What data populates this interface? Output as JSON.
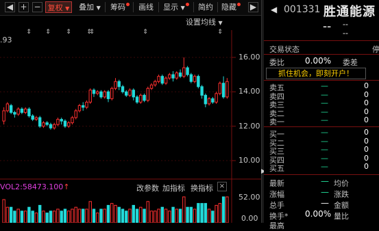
{
  "toolbar": {
    "left_arrow": "◀",
    "plus": "+",
    "minus": "−",
    "fuquan": "复权",
    "diejia": "叠加",
    "chouma": "筹码",
    "huaxian": "画线",
    "xianshi": "显示",
    "jianyue": "简约",
    "yincang": "隐藏",
    "right_arrow": "▶"
  },
  "chart": {
    "settings_label": "设置均线",
    "price_fragment": ".93",
    "y_ticks": [
      "16.00",
      "14.00",
      "12.00",
      "10.00"
    ],
    "vol_label": "VOL2:58473.100",
    "vol_arrow": "↑",
    "vol_buttons": [
      "改参数",
      "加指标",
      "换指标"
    ],
    "vol_close": "×",
    "vol_ticks": [
      "52.00",
      "0.00"
    ]
  },
  "chart_data": {
    "type": "candlestick",
    "ylim": [
      9.0,
      17.0
    ],
    "y_ticks": [
      16,
      14,
      12,
      10
    ],
    "candles": [
      [
        12.3,
        12.9,
        12.1,
        13.1
      ],
      [
        12.9,
        13.3,
        12.8,
        13.4
      ],
      [
        13.2,
        12.8,
        12.7,
        13.3
      ],
      [
        12.8,
        12.7,
        12.5,
        12.9
      ],
      [
        12.7,
        13.0,
        12.6,
        13.1
      ],
      [
        13.0,
        12.8,
        12.7,
        13.1
      ],
      [
        12.8,
        13.0,
        12.7,
        13.1
      ],
      [
        13.0,
        12.6,
        12.5,
        13.1
      ],
      [
        12.6,
        12.4,
        12.3,
        12.7
      ],
      [
        12.4,
        12.5,
        12.3,
        12.6
      ],
      [
        12.5,
        12.0,
        11.9,
        12.6
      ],
      [
        12.0,
        12.2,
        11.9,
        12.3
      ],
      [
        12.2,
        12.1,
        12.0,
        12.3
      ],
      [
        12.1,
        11.9,
        11.8,
        12.2
      ],
      [
        11.9,
        12.1,
        11.8,
        12.2
      ],
      [
        12.1,
        12.4,
        12.0,
        12.5
      ],
      [
        12.4,
        12.3,
        12.1,
        12.5
      ],
      [
        12.3,
        12.0,
        11.9,
        12.4
      ],
      [
        12.0,
        12.2,
        11.9,
        12.3
      ],
      [
        12.2,
        12.5,
        12.1,
        12.6
      ],
      [
        12.5,
        12.9,
        12.4,
        13.0
      ],
      [
        12.9,
        13.2,
        12.8,
        13.3
      ],
      [
        13.2,
        13.1,
        12.9,
        13.4
      ],
      [
        13.1,
        13.4,
        13.0,
        13.5
      ],
      [
        13.4,
        14.1,
        13.3,
        14.2
      ],
      [
        14.1,
        13.9,
        13.7,
        14.2
      ],
      [
        13.9,
        14.0,
        13.8,
        14.1
      ],
      [
        14.0,
        13.7,
        13.6,
        14.1
      ],
      [
        13.7,
        14.0,
        13.6,
        14.1
      ],
      [
        14.0,
        13.6,
        13.4,
        14.1
      ],
      [
        13.6,
        14.2,
        13.5,
        14.3
      ],
      [
        14.2,
        14.6,
        14.1,
        14.8
      ],
      [
        14.6,
        14.3,
        14.1,
        14.7
      ],
      [
        14.3,
        14.0,
        13.9,
        14.4
      ],
      [
        14.0,
        13.8,
        13.7,
        14.1
      ],
      [
        13.8,
        14.1,
        13.7,
        14.2
      ],
      [
        14.1,
        13.7,
        13.5,
        14.2
      ],
      [
        13.7,
        13.4,
        13.3,
        13.8
      ],
      [
        13.4,
        13.8,
        13.3,
        13.9
      ],
      [
        13.8,
        13.5,
        13.4,
        13.9
      ],
      [
        13.5,
        14.2,
        13.4,
        14.3
      ],
      [
        14.2,
        14.4,
        14.1,
        14.5
      ],
      [
        14.4,
        14.6,
        14.3,
        14.7
      ],
      [
        14.6,
        14.9,
        14.5,
        15.0
      ],
      [
        14.9,
        14.5,
        14.4,
        15.0
      ],
      [
        14.5,
        14.8,
        14.4,
        14.9
      ],
      [
        14.8,
        15.0,
        14.7,
        15.1
      ],
      [
        15.0,
        14.8,
        14.6,
        15.2
      ],
      [
        14.8,
        15.1,
        14.7,
        15.2
      ],
      [
        15.1,
        14.9,
        14.8,
        15.3
      ],
      [
        14.9,
        15.4,
        14.8,
        16.0
      ],
      [
        15.4,
        15.0,
        14.9,
        15.5
      ],
      [
        15.0,
        14.6,
        14.5,
        15.1
      ],
      [
        14.6,
        14.9,
        14.5,
        15.0
      ],
      [
        14.9,
        14.3,
        14.2,
        15.0
      ],
      [
        14.3,
        13.8,
        13.6,
        14.4
      ],
      [
        13.8,
        13.3,
        13.1,
        13.9
      ],
      [
        13.3,
        13.6,
        13.2,
        13.7
      ],
      [
        13.6,
        13.4,
        13.3,
        13.7
      ],
      [
        13.4,
        13.9,
        13.3,
        14.0
      ],
      [
        13.9,
        14.5,
        13.8,
        14.6
      ],
      [
        14.5,
        13.7,
        13.6,
        14.9
      ],
      [
        13.7,
        14.6,
        13.6,
        14.8
      ]
    ]
  },
  "quote": {
    "code": "001331",
    "name": "胜通能源",
    "price": "--",
    "change_top": "--",
    "change_bottom": "--",
    "trade_status_label": "交易状态",
    "trade_status_value": "停",
    "weibi_label": "委比",
    "weibi_value": "0.00%",
    "weicha_label": "委差",
    "promo": "抓住机会，即刻开户！",
    "sell_labels": [
      "卖五",
      "卖四",
      "卖三",
      "卖二",
      "卖一"
    ],
    "buy_labels": [
      "买一",
      "买二",
      "买三",
      "买四",
      "买五"
    ],
    "dash": "—",
    "qty": "0",
    "stats": {
      "zuixin": "最新",
      "junjia": "均价",
      "zhangfu": "涨幅",
      "zhangdie": "涨跌",
      "zongshou": "总手",
      "jine": "金额",
      "huanshou": "换手*",
      "huanshou_value": "0.00%",
      "liangbi": "量比",
      "last_row": "最高"
    }
  }
}
